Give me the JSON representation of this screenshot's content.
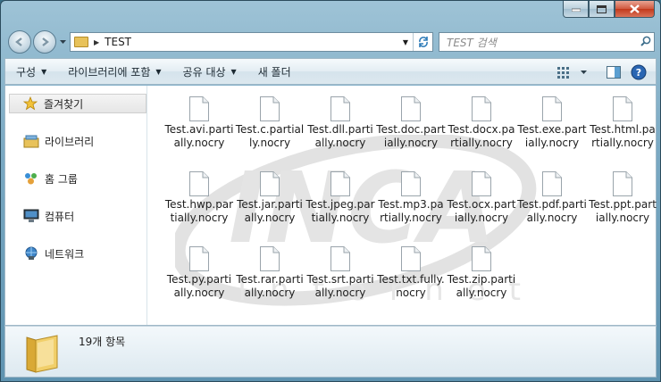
{
  "window": {
    "address_path": "TEST",
    "search_placeholder": "TEST 검색"
  },
  "command_bar": {
    "organize": "구성",
    "include_library": "라이브러리에 포함",
    "share_with": "공유 대상",
    "new_folder": "새 폴더"
  },
  "sidebar": {
    "items": [
      {
        "label": "즐겨찾기",
        "icon": "star-icon"
      },
      {
        "label": "라이브러리",
        "icon": "library-icon"
      },
      {
        "label": "홈 그룹",
        "icon": "homegroup-icon"
      },
      {
        "label": "컴퓨터",
        "icon": "computer-icon"
      },
      {
        "label": "네트워크",
        "icon": "network-icon"
      }
    ]
  },
  "files": [
    {
      "name": "Test.avi.partially.nocry"
    },
    {
      "name": "Test.c.partially.nocry"
    },
    {
      "name": "Test.dll.partially.nocry"
    },
    {
      "name": "Test.doc.partially.nocry"
    },
    {
      "name": "Test.docx.partially.nocry"
    },
    {
      "name": "Test.exe.partially.nocry"
    },
    {
      "name": "Test.html.partially.nocry"
    },
    {
      "name": "Test.hwp.partially.nocry"
    },
    {
      "name": "Test.jar.partially.nocry"
    },
    {
      "name": "Test.jpeg.partially.nocry"
    },
    {
      "name": "Test.mp3.partially.nocry"
    },
    {
      "name": "Test.ocx.partially.nocry"
    },
    {
      "name": "Test.pdf.partially.nocry"
    },
    {
      "name": "Test.ppt.partially.nocry"
    },
    {
      "name": "Test.py.partially.nocry"
    },
    {
      "name": "Test.rar.partially.nocry"
    },
    {
      "name": "Test.srt.partially.nocry"
    },
    {
      "name": "Test.txt.fully.nocry"
    },
    {
      "name": "Test.zip.partially.nocry"
    }
  ],
  "details": {
    "item_count": "19개 항목"
  },
  "watermark": {
    "brand": "INCA",
    "sub": "Internet"
  },
  "colors": {
    "frame": "#7aa9c3",
    "folder": "#e8c25a",
    "accent": "#2d7bb8"
  }
}
